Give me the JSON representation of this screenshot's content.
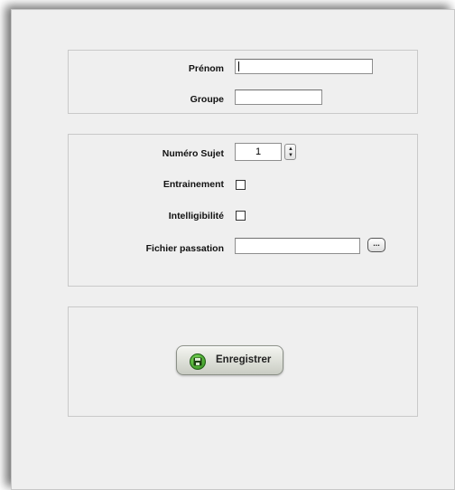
{
  "identity": {
    "firstname_label": "Prénom",
    "firstname_value": "",
    "group_label": "Groupe",
    "group_value": ""
  },
  "session": {
    "subject_number_label": "Numéro Sujet",
    "subject_number_value": "1",
    "training_label": "Entrainement",
    "training_checked": false,
    "intelligibility_label": "Intelligibilité",
    "intelligibility_checked": false,
    "file_label": "Fichier passation",
    "file_value": "",
    "browse_label": "..."
  },
  "actions": {
    "save_label": "Enregistrer",
    "save_icon": "floppy-disk-icon"
  }
}
